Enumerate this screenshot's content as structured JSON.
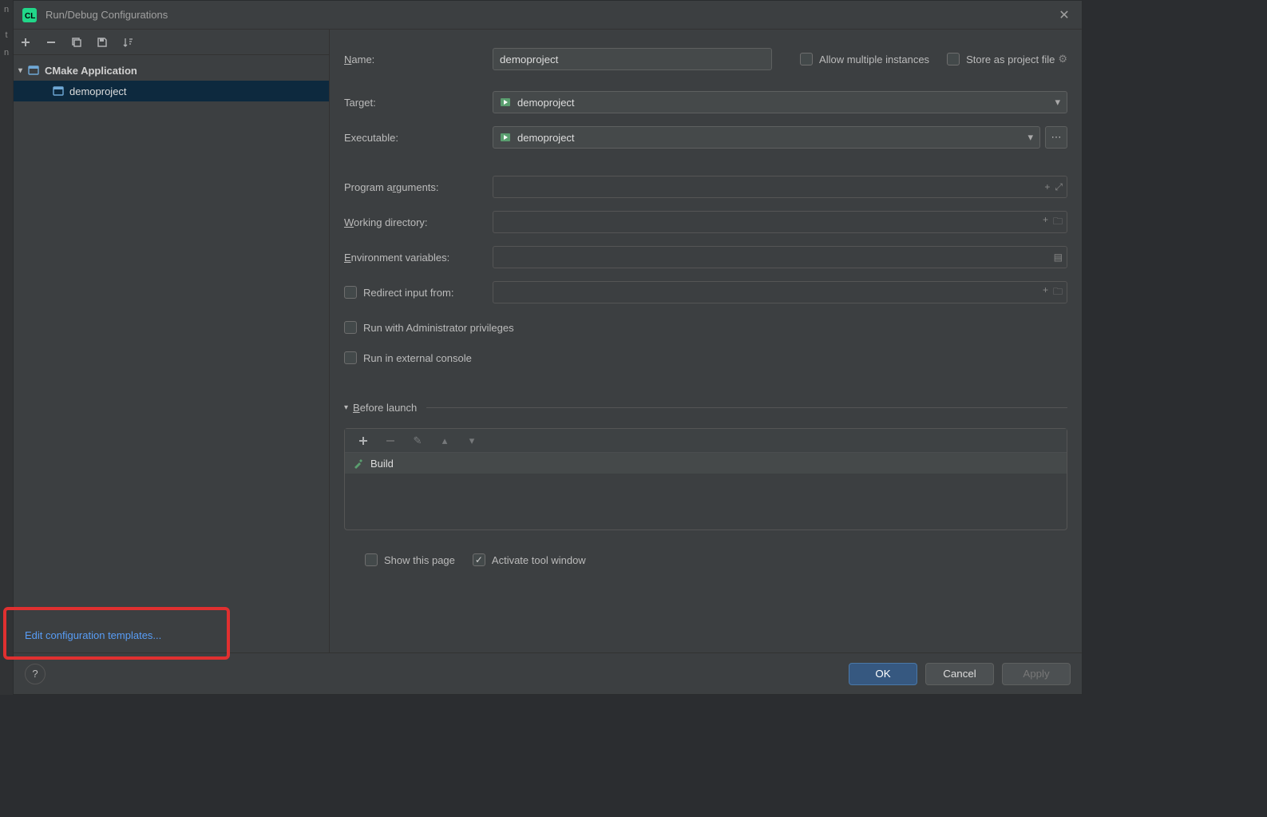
{
  "title": "Run/Debug Configurations",
  "sidebar": {
    "group_label": "CMake Application",
    "item_label": "demoproject",
    "edit_templates": "Edit configuration templates..."
  },
  "form": {
    "name_label": "Name:",
    "name_value": "demoproject",
    "allow_multiple": "Allow multiple instances",
    "store_as_file": "Store as project file",
    "target_label": "Target:",
    "target_value": "demoproject",
    "exe_label": "Executable:",
    "exe_value": "demoproject",
    "program_args_label": "Program arguments:",
    "program_args_value": "",
    "working_dir_label": "Working directory:",
    "working_dir_value": "",
    "env_vars_label": "Environment variables:",
    "env_vars_value": "",
    "redirect_input_label": "Redirect input from:",
    "admin_label": "Run with Administrator privileges",
    "external_console_label": "Run in external console",
    "before_launch_label": "Before launch",
    "build_label": "Build",
    "show_this_page": "Show this page",
    "activate_tool_window": "Activate tool window"
  },
  "buttons": {
    "help": "?",
    "ok": "OK",
    "cancel": "Cancel",
    "apply": "Apply"
  }
}
